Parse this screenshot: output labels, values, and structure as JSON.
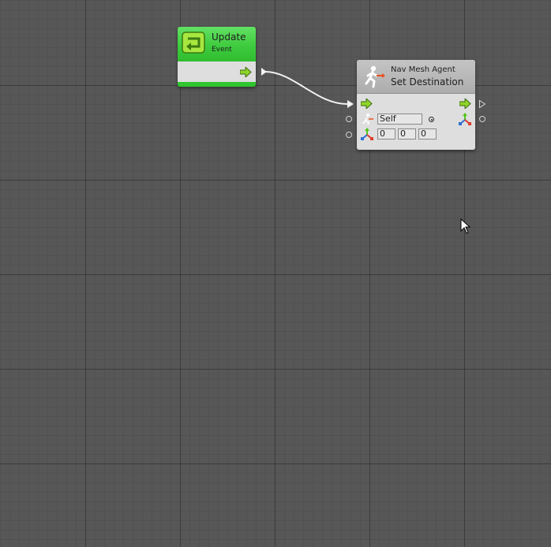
{
  "graph": {
    "background": "#575757",
    "nodes": {
      "update_event": {
        "title": "Update",
        "subtitle": "Event",
        "color": "#3fcb3f",
        "icon": "loop-arrow-icon",
        "outputs": [
          "flow-out-arrow"
        ]
      },
      "set_destination": {
        "class_label": "Nav Mesh Agent",
        "method_label": "Set Destination",
        "header_color": "#b9b9b9",
        "icon": "running-man-icon",
        "target_field": {
          "value": "Self",
          "icon": "nav-agent-icon"
        },
        "destination_fields": {
          "icon": "xyz-axis-icon",
          "x": "0",
          "y": "0",
          "z": "0"
        },
        "outputs": [
          "flow-out-arrow",
          "xyz-axis-icon"
        ]
      }
    },
    "connections": [
      {
        "from": "Update.flow-out",
        "to": "Set Destination.flow-in"
      }
    ]
  }
}
